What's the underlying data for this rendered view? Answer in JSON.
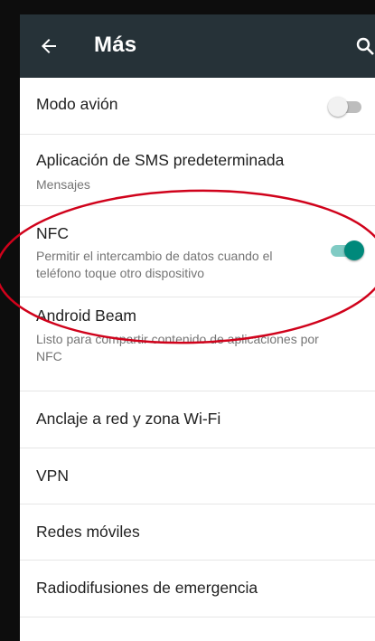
{
  "appbar": {
    "title": "Más",
    "back_icon": "arrow-left-icon",
    "search_icon": "search-icon",
    "color": "#263238"
  },
  "items": [
    {
      "title": "Modo avión",
      "toggle": {
        "on": false
      }
    },
    {
      "title": "Aplicación de SMS predeterminada",
      "subtitle": "Mensajes"
    },
    {
      "title": "NFC",
      "subtitle_line1": "Permitir el intercambio de datos cuando el",
      "subtitle_line2": "teléfono toque otro dispositivo",
      "toggle": {
        "on": true
      }
    },
    {
      "title": "Android Beam",
      "subtitle_line1": "Listo para compartir contenido de aplicaciones por",
      "subtitle_line2": "NFC"
    },
    {
      "title": "Anclaje a red y zona Wi-Fi"
    },
    {
      "title": "VPN"
    },
    {
      "title": "Redes móviles"
    },
    {
      "title": "Radiodifusiones de emergencia"
    }
  ],
  "colors": {
    "accent": "#00897b",
    "accent_track": "#80cbc4",
    "annotation": "#d0021b"
  }
}
